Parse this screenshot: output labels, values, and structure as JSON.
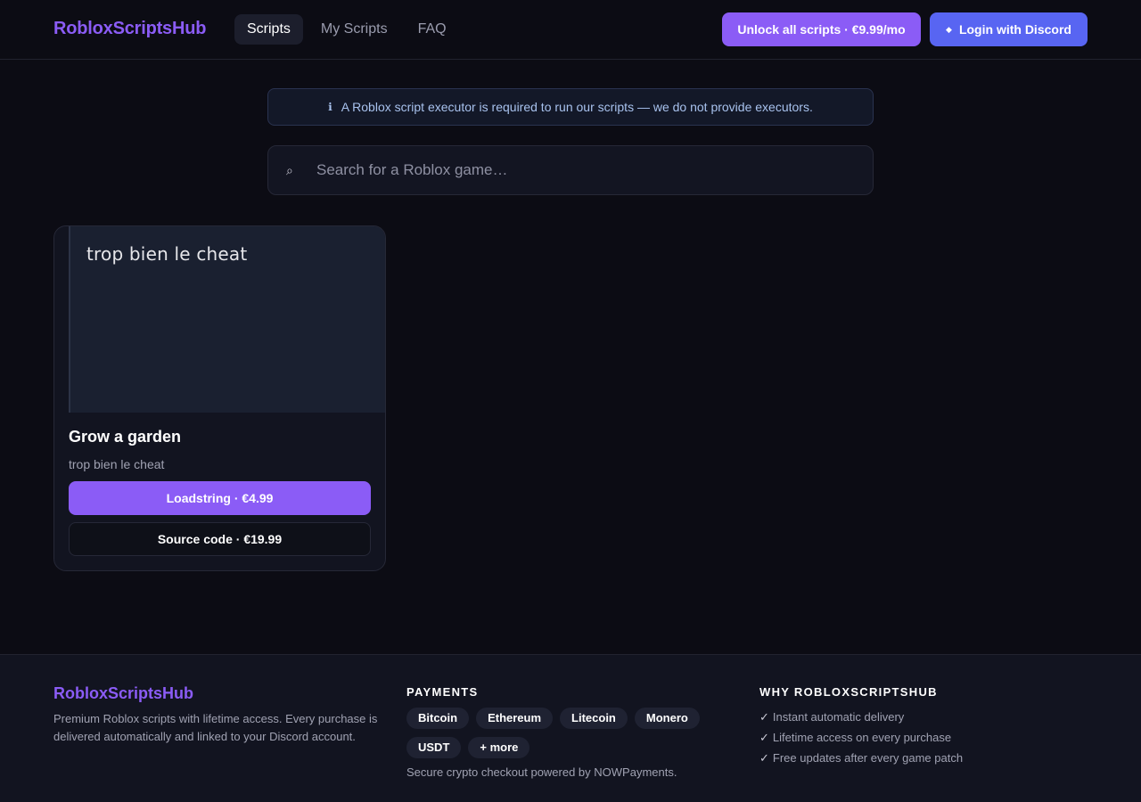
{
  "header": {
    "brand": "RobloxScriptsHub",
    "nav": [
      {
        "label": "Scripts",
        "active": true
      },
      {
        "label": "My Scripts",
        "active": false
      },
      {
        "label": "FAQ",
        "active": false
      }
    ],
    "unlock_label": "Unlock all scripts · €9.99/mo",
    "discord_label": "Login with Discord",
    "discord_icon": "◆"
  },
  "notice": {
    "icon": "ℹ",
    "text": "A Roblox script executor is required to run our scripts — we do not provide executors."
  },
  "search": {
    "icon": "⌕",
    "placeholder": "Search for a Roblox game…",
    "value": ""
  },
  "cards": [
    {
      "thumb_text": "trop bien le cheat",
      "title": "Grow a garden",
      "description": "trop bien le cheat",
      "loadstring_label": "Loadstring · €4.99",
      "source_label": "Source code · €19.99"
    }
  ],
  "footer": {
    "brand": "RobloxScriptsHub",
    "about": "Premium Roblox scripts with lifetime access. Every purchase is delivered automatically and linked to your Discord account.",
    "payments_heading": "PAYMENTS",
    "payments": [
      "Bitcoin",
      "Ethereum",
      "Litecoin",
      "Monero",
      "USDT",
      "+ more"
    ],
    "payments_note": "Secure crypto checkout powered by NOWPayments.",
    "why_heading": "WHY ROBLOXSCRIPTSHUB",
    "check_icon": "✓",
    "why": [
      "Instant automatic delivery",
      "Lifetime access on every purchase",
      "Free updates after every game patch"
    ]
  },
  "colors": {
    "accent": "#8b5cf6",
    "discord": "#5865f2",
    "background": "#0c0c14"
  }
}
